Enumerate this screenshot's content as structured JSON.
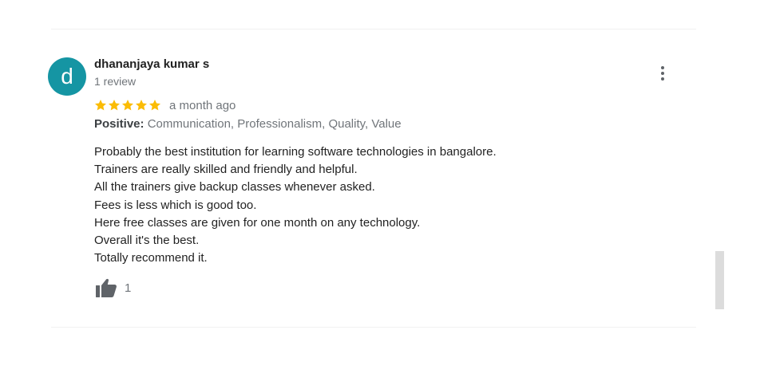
{
  "review": {
    "avatar_letter": "d",
    "avatar_color": "#1595a3",
    "reviewer_name": "dhananjaya kumar s",
    "review_count": "1 review",
    "rating": 5,
    "rating_max": 5,
    "star_color": "#fbbc04",
    "time_ago": "a month ago",
    "positive_label": "Positive:",
    "positive_values": "Communication, Professionalism, Quality, Value",
    "text_lines": [
      "Probably the best institution for learning software technologies in bangalore.",
      "Trainers are really skilled and friendly and helpful.",
      "All the trainers give backup classes whenever asked.",
      "Fees is less which is good too.",
      "Here free classes are given for one month on any technology.",
      "Overall it's the best.",
      "Totally recommend it."
    ],
    "like_icon": "thumbs-up-icon",
    "like_count": "1",
    "more_icon": "more-vertical-icon"
  }
}
